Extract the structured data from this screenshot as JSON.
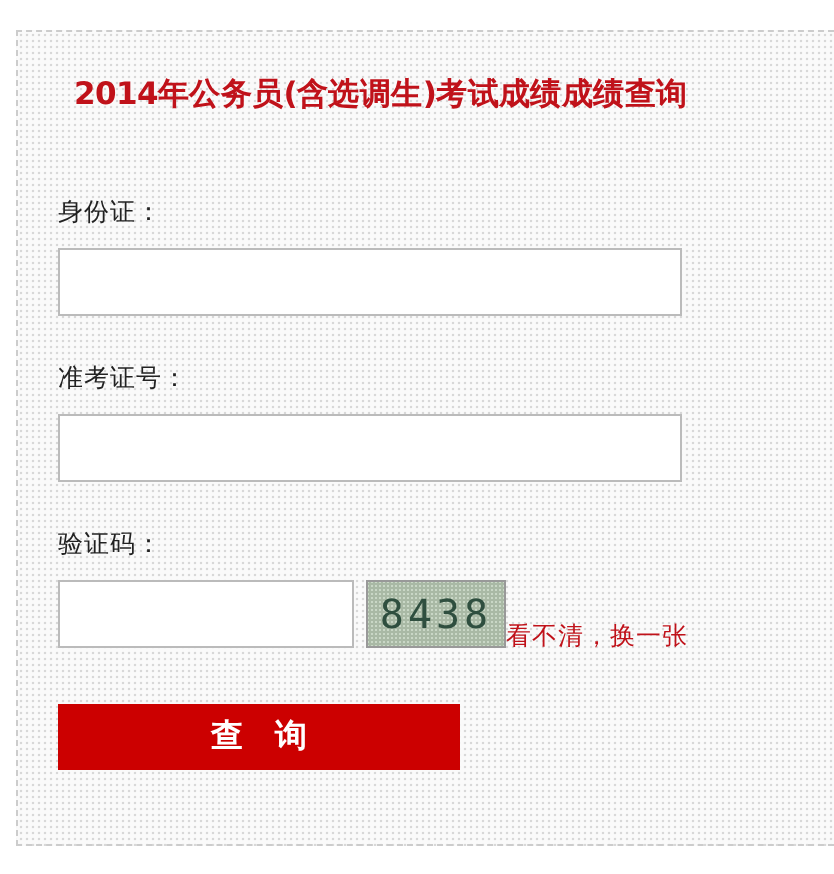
{
  "title": "2014年公务员(含选调生)考试成绩成绩查询",
  "fields": [
    {
      "label": "身份证："
    },
    {
      "label": "准考证号："
    }
  ],
  "captcha": {
    "label": "验证码：",
    "code": "8438",
    "refresh_link": "看不清，换一张"
  },
  "submit_button": "查　询"
}
